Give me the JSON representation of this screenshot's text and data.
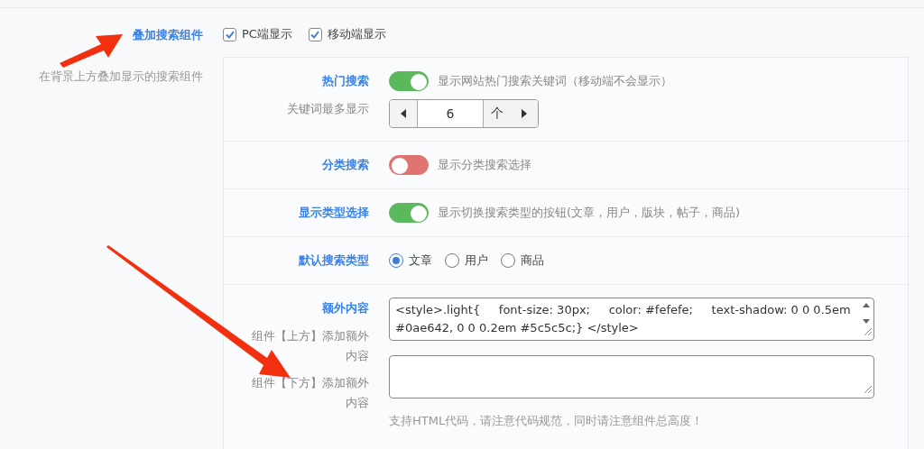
{
  "section": {
    "title": "叠加搜索组件",
    "description": "在背景上方叠加显示的搜索组件",
    "checkboxes": [
      {
        "label": "PC端显示",
        "checked": true
      },
      {
        "label": "移动端显示",
        "checked": true
      }
    ]
  },
  "options": [
    {
      "kind": "switch",
      "title": "热门搜索",
      "on": true,
      "hint": "显示网站热门搜索关键词（移动端不会显示）",
      "stepper": {
        "label": "关键词最多显示",
        "value": "6",
        "unit": "个"
      }
    },
    {
      "kind": "switch",
      "title": "分类搜索",
      "on": false,
      "hint": "显示分类搜索选择"
    },
    {
      "kind": "switch",
      "title": "显示类型选择",
      "on": true,
      "hint": "显示切换搜索类型的按钮(文章，用户，版块，帖子，商品)"
    },
    {
      "kind": "radio",
      "title": "默认搜索类型",
      "choices": [
        {
          "label": "文章",
          "selected": true
        },
        {
          "label": "用户",
          "selected": false
        },
        {
          "label": "商品",
          "selected": false
        }
      ]
    },
    {
      "kind": "textareas",
      "title": "额外内容",
      "fields": [
        {
          "label": "组件【上方】添加额外内容",
          "value": "<style>.light{     font-size: 30px;     color: #fefefe;     text-shadow: 0 0 0.5em #0ae642, 0 0 0.2em #5c5c5c;} </style>"
        },
        {
          "label": "组件【下方】添加额外内容"
        }
      ],
      "note": "支持HTML代码，请注意代码规范，同时请注意组件总高度！"
    }
  ]
}
